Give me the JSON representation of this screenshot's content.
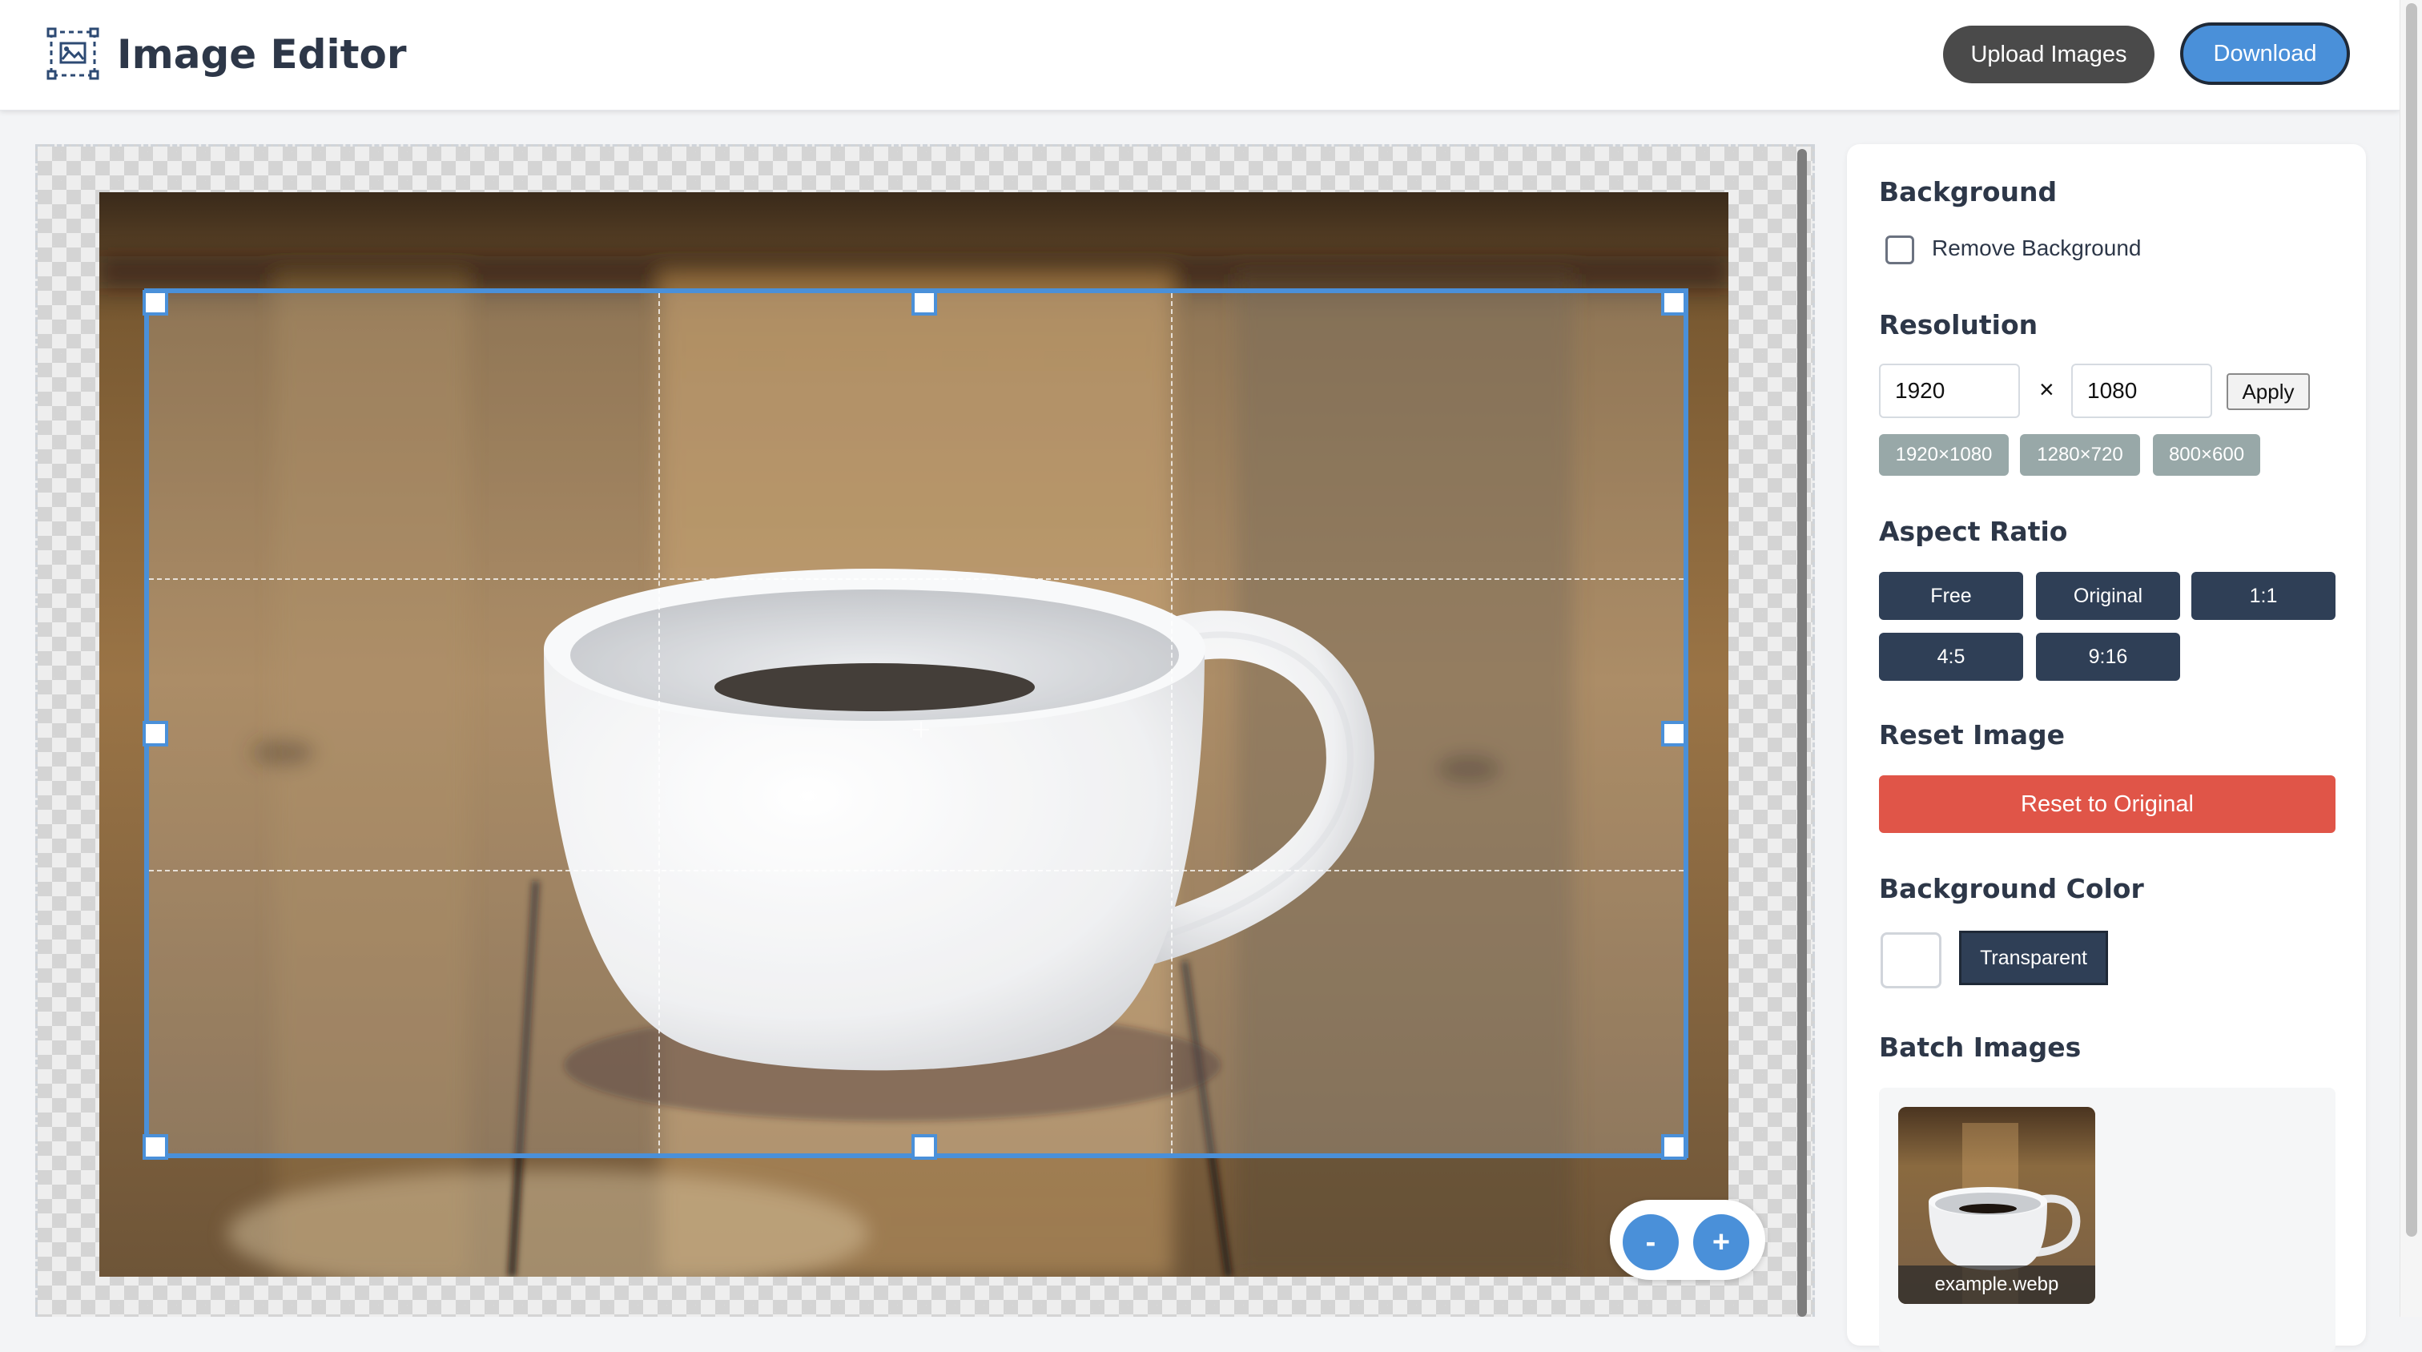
{
  "header": {
    "title": "Image Editor",
    "upload_label": "Upload Images",
    "download_label": "Download"
  },
  "canvas": {
    "zoom_out_label": "-",
    "zoom_in_label": "+"
  },
  "panel": {
    "background": {
      "title": "Background",
      "remove_label": "Remove Background",
      "remove_checked": false
    },
    "resolution": {
      "title": "Resolution",
      "width_value": "1920",
      "height_value": "1080",
      "times_symbol": "×",
      "apply_label": "Apply",
      "presets": [
        "1920×1080",
        "1280×720",
        "800×600"
      ]
    },
    "aspect_ratio": {
      "title": "Aspect Ratio",
      "options": [
        "Free",
        "Original",
        "1:1",
        "4:5",
        "9:16"
      ]
    },
    "reset": {
      "title": "Reset Image",
      "button_label": "Reset to Original"
    },
    "bg_color": {
      "title": "Background Color",
      "swatch_color": "#ffffff",
      "transparent_label": "Transparent"
    },
    "batch": {
      "title": "Batch Images",
      "items": [
        {
          "filename": "example.webp"
        }
      ]
    }
  },
  "colors": {
    "accent": "#4a90d9",
    "danger": "#e05548",
    "dark_button": "#2f3f56",
    "preset_button": "#98a8a8"
  }
}
